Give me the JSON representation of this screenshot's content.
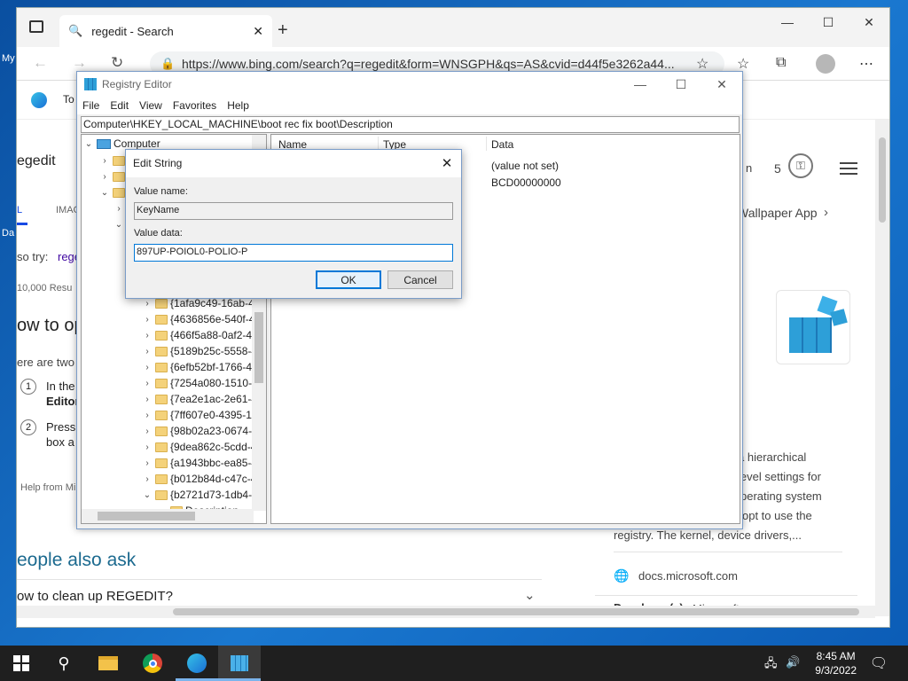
{
  "desktop": {
    "label_top": "My",
    "label_bottom": "Da"
  },
  "browser": {
    "tab_title": "regedit - Search",
    "url": "https://www.bing.com/search?q=regedit&form=WNSGPH&qs=AS&cvid=d44f5e3262a44...",
    "favbar_text": "To"
  },
  "bing": {
    "search_query": "egedit",
    "tab_all": "L",
    "tab_images": "IMAG",
    "also_try_label": "so try:",
    "also_try_link": "rege",
    "results_count": "10,000 Resu",
    "heading": "ow to op",
    "intro": "ere are two",
    "step1_num": "1",
    "step1_text_a": "In the",
    "step1_text_b": "Editor",
    "step2_num": "2",
    "step2_text_a": "Press",
    "step2_text_b": "box a",
    "help_from": "Help from Mi",
    "people_also_ask": "eople also ask",
    "question1": "ow to clean up REGEDIT?",
    "rewards_count": "5",
    "wallpaper_link": "Wallpaper App",
    "search_box_partial": "n",
    "side_desc_1": "a hierarchical",
    "side_desc_2": "level settings for",
    "side_desc_3": "perating system",
    "side_desc_4": "opt to use the",
    "side_desc_5": "registry. The kernel, device drivers,...",
    "source_domain": "docs.microsoft.com",
    "developer_label": "Developer(s)",
    "developer_value": "Microsoft"
  },
  "regedit": {
    "title": "Registry Editor",
    "menu": [
      "File",
      "Edit",
      "View",
      "Favorites",
      "Help"
    ],
    "path": "Computer\\HKEY_LOCAL_MACHINE\\boot rec fix boot\\Description",
    "tree_root": "Computer",
    "tree_items": [
      "{1afa9c49-16ab-4",
      "{4636856e-540f-4",
      "{466f5a88-0af2-4f",
      "{5189b25c-5558-4",
      "{6efb52bf-1766-4",
      "{7254a080-1510-4",
      "{7ea2e1ac-2e61-4",
      "{7ff607e0-4395-1",
      "{98b02a23-0674-4",
      "{9dea862c-5cdd-4",
      "{a1943bbc-ea85-4",
      "{b012b84d-c47c-4",
      "{b2721d73-1db4-4"
    ],
    "tree_child": "Description",
    "columns": [
      "Name",
      "Type",
      "Data"
    ],
    "rows": [
      {
        "data": "(value not set)"
      },
      {
        "data": "BCD00000000"
      }
    ]
  },
  "dialog": {
    "title": "Edit String",
    "value_name_label": "Value name:",
    "value_name": "KeyName",
    "value_data_label": "Value data:",
    "value_data": "897UP-POIOL0-POLIO-P",
    "ok_label": "OK",
    "cancel_label": "Cancel"
  },
  "taskbar": {
    "time": "8:45 AM",
    "date": "9/3/2022"
  }
}
